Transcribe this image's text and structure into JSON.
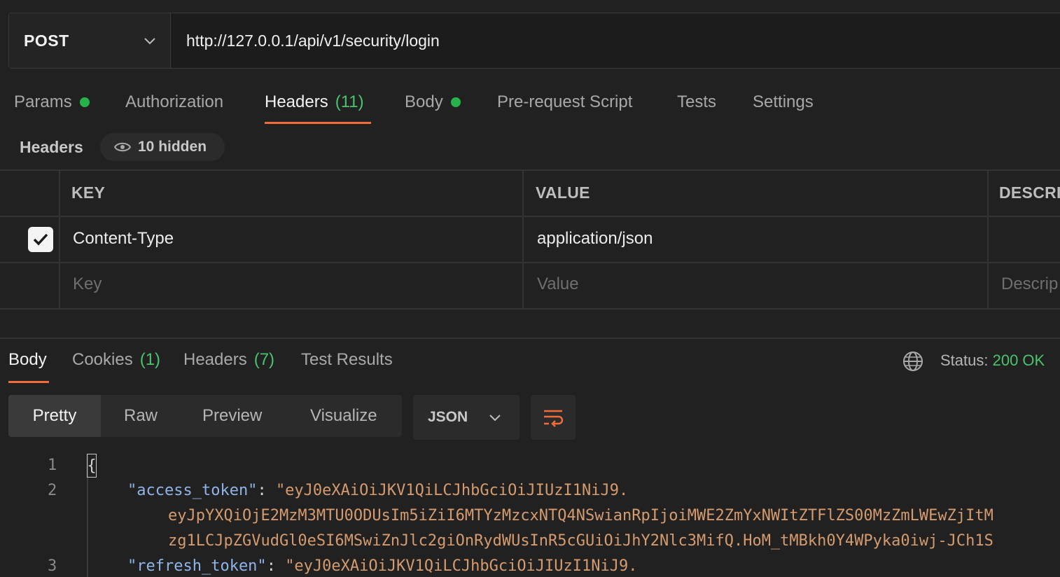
{
  "request": {
    "method": "POST",
    "url": "http://127.0.0.1/api/v1/security/login"
  },
  "request_tabs": [
    {
      "label": "Params",
      "dot": true
    },
    {
      "label": "Authorization"
    },
    {
      "label": "Headers",
      "count": "(11)",
      "active": true
    },
    {
      "label": "Body",
      "dot": true
    },
    {
      "label": "Pre-request Script"
    },
    {
      "label": "Tests"
    },
    {
      "label": "Settings"
    }
  ],
  "headers_section": {
    "title": "Headers",
    "hidden_label": "10 hidden"
  },
  "table": {
    "columns": [
      "KEY",
      "VALUE",
      "DESCRI"
    ],
    "rows": [
      {
        "checked": true,
        "key": "Content-Type",
        "value": "application/json"
      }
    ],
    "placeholders": {
      "key": "Key",
      "value": "Value",
      "description": "Descrip"
    }
  },
  "response_tabs": [
    {
      "label": "Body",
      "active": true
    },
    {
      "label": "Cookies",
      "count": "(1)"
    },
    {
      "label": "Headers",
      "count": "(7)"
    },
    {
      "label": "Test Results"
    }
  ],
  "status": {
    "label": "Status:",
    "value": "200 OK"
  },
  "view_modes": [
    "Pretty",
    "Raw",
    "Preview",
    "Visualize"
  ],
  "format": "JSON",
  "code": {
    "line_numbers": [
      "1",
      "2",
      "3"
    ],
    "brace": "{",
    "access_key": "\"access_token\"",
    "colon": ":",
    "access_value_1": "\"eyJ0eXAiOiJKV1QiLCJhbGciOiJIUzI1NiJ9.",
    "access_value_2": "eyJpYXQiOjE2MzM3MTU0ODUsIm5iZiI6MTYzMzcxNTQ4NSwianRpIjoiMWE2ZmYxNWItZTFlZS00MzZmLWEwZjItM",
    "access_value_3": "zg1LCJpZGVudGl0eSI6MSwiZnJlc2giOnRydWUsInR5cGUiOiJhY2Nlc3MifQ.HoM_tMBkh0Y4WPyka0iwj-JCh1S",
    "refresh_key": "\"refresh_token\"",
    "refresh_value_1": "\"eyJ0eXAiOiJKV1QiLCJhbGciOiJIUzI1NiJ9."
  },
  "colors": {
    "accent": "#f26b3a",
    "success": "#49c46c",
    "background": "#212121"
  }
}
